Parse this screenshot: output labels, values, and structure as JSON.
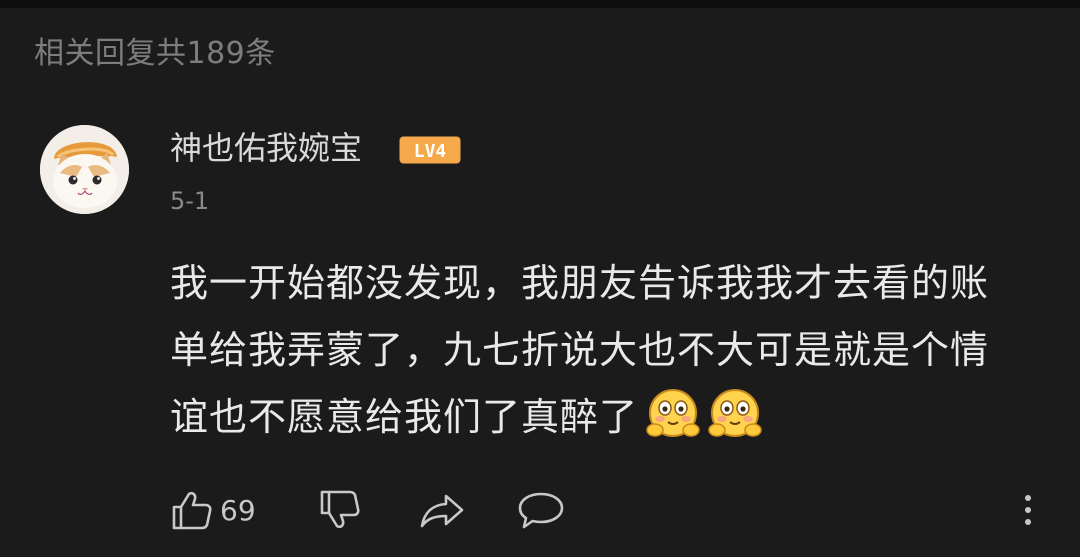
{
  "header": {
    "reply_count_text": "相关回复共189条"
  },
  "comment": {
    "username": "神也佑我婉宝",
    "level": "LV4",
    "date": "5-1",
    "lines": [
      "我一开始都没发现，我朋友告诉我我才去看的账",
      "单给我弄蒙了，九七折说大也不大可是就是个情",
      "谊也不愿意给我们了真醉了"
    ],
    "emojis": [
      "shy-face-emoji",
      "shy-face-emoji"
    ],
    "like_count": "69"
  },
  "colors": {
    "background": "#1b1b1b",
    "text_primary": "#e9e9e9",
    "text_secondary": "#7d7d7d",
    "badge_orange": "#f5a94a",
    "emoji_yellow": "#ffd34e"
  },
  "icons": [
    "thumbs-up-icon",
    "thumbs-down-icon",
    "share-icon",
    "comment-icon",
    "more-icon"
  ]
}
